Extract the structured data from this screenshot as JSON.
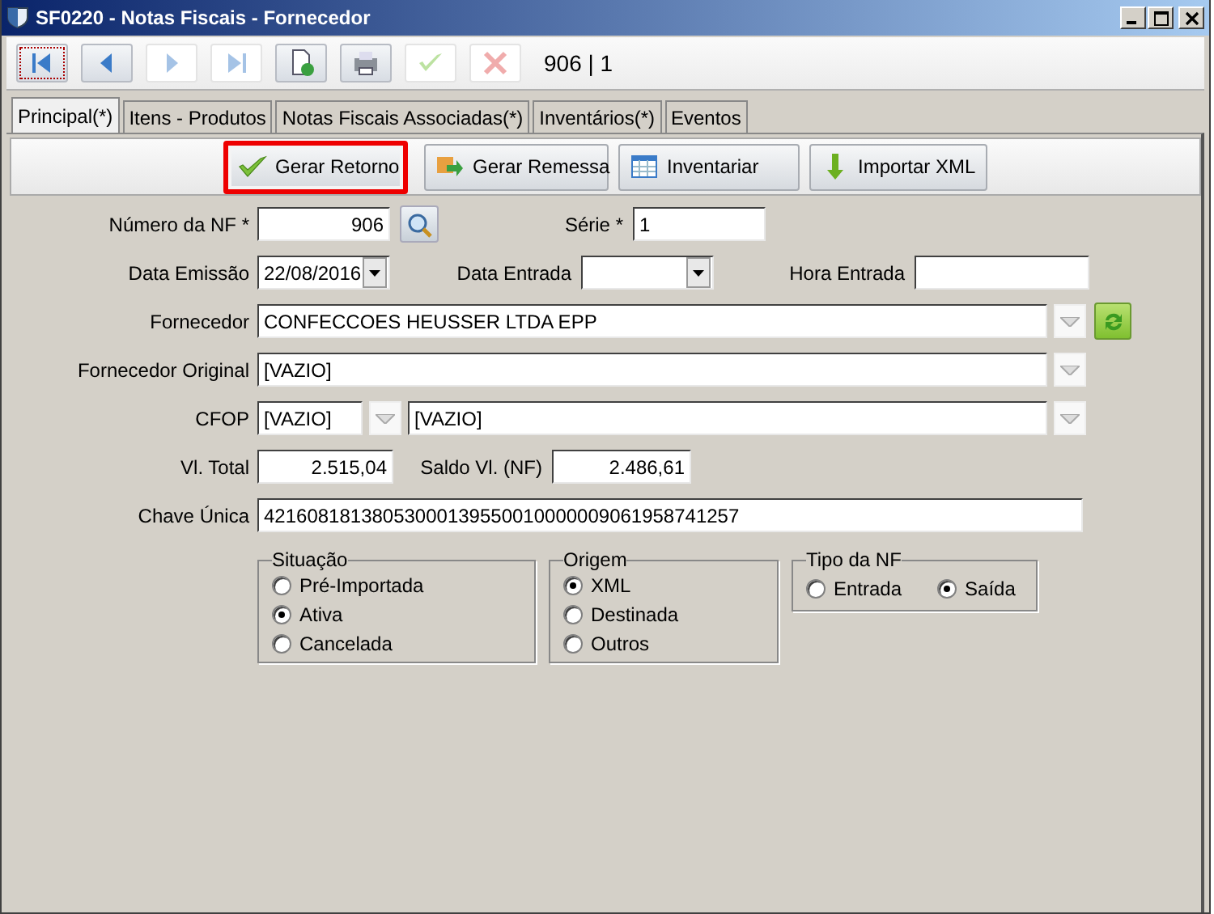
{
  "window": {
    "title": "SF0220 - Notas Fiscais - Fornecedor"
  },
  "toolbar": {
    "buttons": [
      {
        "kind": "first",
        "disabled": false
      },
      {
        "kind": "prev",
        "disabled": false
      },
      {
        "kind": "next",
        "disabled": true
      },
      {
        "kind": "last",
        "disabled": true
      },
      {
        "kind": "new",
        "disabled": false
      },
      {
        "kind": "print",
        "disabled": false
      },
      {
        "kind": "confirm",
        "disabled": true
      },
      {
        "kind": "cancel",
        "disabled": true
      }
    ],
    "record": "906 | 1"
  },
  "tabs": [
    {
      "label": "Principal(*)",
      "selected": true
    },
    {
      "label": "Itens - Produtos",
      "selected": false
    },
    {
      "label": "Notas Fiscais Associadas(*)",
      "selected": false
    },
    {
      "label": "Inventários(*)",
      "selected": false
    },
    {
      "label": "Eventos",
      "selected": false
    }
  ],
  "actions": [
    {
      "kind": "check",
      "label": "Gerar Retorno",
      "highlighted": true
    },
    {
      "kind": "send",
      "label": "Gerar Remessa",
      "highlighted": false
    },
    {
      "kind": "grid",
      "label": "Inventariar",
      "highlighted": false
    },
    {
      "kind": "download",
      "label": "Importar XML",
      "highlighted": false
    }
  ],
  "form": {
    "numero_nf": {
      "label": "Número da NF *",
      "value": "906"
    },
    "serie": {
      "label": "Série *",
      "value": "1"
    },
    "data_emissao": {
      "label": "Data Emissão",
      "value": "22/08/2016"
    },
    "data_entrada": {
      "label": "Data Entrada"
    },
    "hora_entrada": {
      "label": "Hora Entrada"
    },
    "fornecedor": {
      "label": "Fornecedor",
      "value": "CONFECCOES HEUSSER LTDA EPP"
    },
    "fornecedor_original": {
      "label": "Fornecedor Original",
      "value": "[VAZIO]"
    },
    "cfop": {
      "label": "CFOP",
      "code": "[VAZIO]",
      "description": "[VAZIO]"
    },
    "vl_total": {
      "label": "Vl. Total",
      "value": "2.515,04"
    },
    "saldo": {
      "label": "Saldo Vl. (NF)",
      "value": "2.486,61"
    },
    "chave": {
      "label": "Chave Única",
      "value": "42160818138053000139550010000009061958741257"
    }
  },
  "groups": [
    {
      "title": "Situação",
      "kind": "column",
      "options": [
        {
          "label": "Pré-Importada",
          "selected": false
        },
        {
          "label": "Ativa",
          "selected": true
        },
        {
          "label": "Cancelada",
          "selected": false
        }
      ]
    },
    {
      "title": "Origem",
      "kind": "column",
      "options": [
        {
          "label": "XML",
          "selected": true
        },
        {
          "label": "Destinada",
          "selected": false
        },
        {
          "label": "Outros",
          "selected": false
        }
      ]
    },
    {
      "title": "Tipo da NF",
      "kind": "row",
      "options": [
        {
          "label": "Entrada",
          "selected": false
        },
        {
          "label": "Saída",
          "selected": true
        }
      ]
    }
  ]
}
